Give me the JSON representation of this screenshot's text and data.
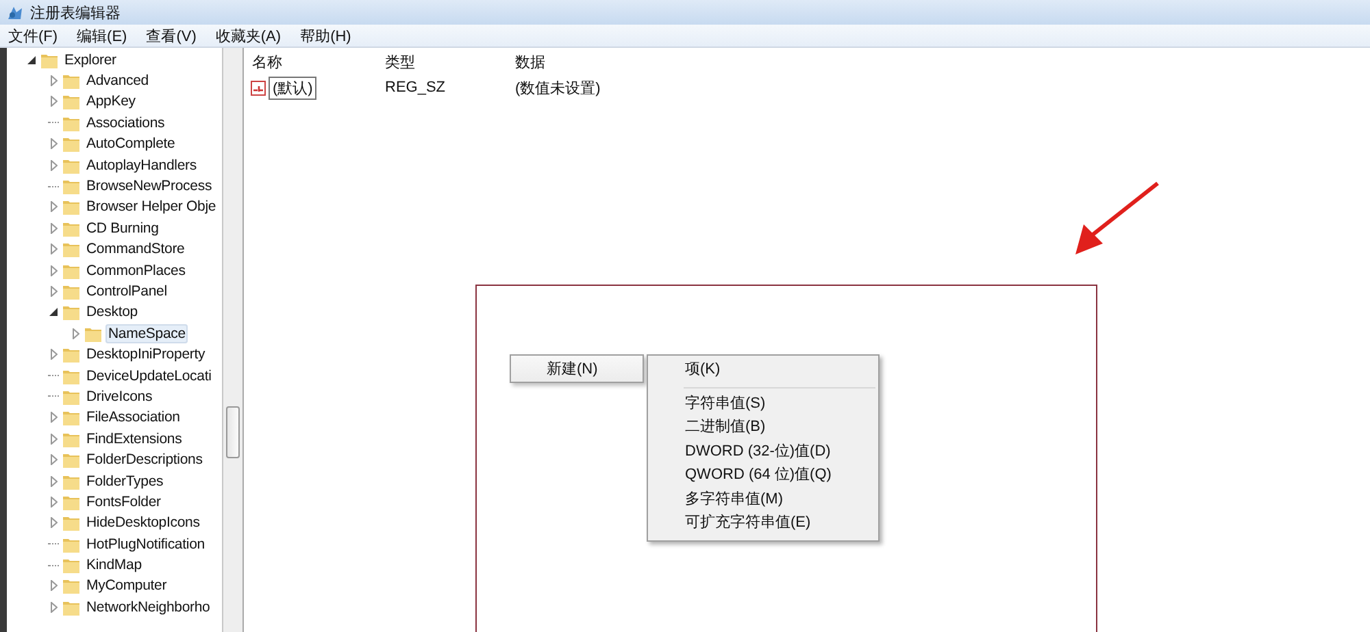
{
  "window": {
    "title": "注册表编辑器"
  },
  "menu_bar": [
    "文件(F)",
    "编辑(E)",
    "查看(V)",
    "收藏夹(A)",
    "帮助(H)"
  ],
  "tree": {
    "label": "Explorer",
    "kind": "branch",
    "expanded": true,
    "selected": false,
    "children": [
      {
        "label": "Advanced",
        "kind": "branch",
        "expanded": false,
        "selected": false
      },
      {
        "label": "AppKey",
        "kind": "branch",
        "expanded": false,
        "selected": false
      },
      {
        "label": "Associations",
        "kind": "leaf",
        "selected": false
      },
      {
        "label": "AutoComplete",
        "kind": "branch",
        "expanded": false,
        "selected": false
      },
      {
        "label": "AutoplayHandlers",
        "kind": "branch",
        "expanded": false,
        "selected": false
      },
      {
        "label": "BrowseNewProcess",
        "kind": "leaf",
        "selected": false
      },
      {
        "label": "Browser Helper Obje",
        "kind": "branch",
        "expanded": false,
        "selected": false
      },
      {
        "label": "CD Burning",
        "kind": "branch",
        "expanded": false,
        "selected": false
      },
      {
        "label": "CommandStore",
        "kind": "branch",
        "expanded": false,
        "selected": false
      },
      {
        "label": "CommonPlaces",
        "kind": "branch",
        "expanded": false,
        "selected": false
      },
      {
        "label": "ControlPanel",
        "kind": "branch",
        "expanded": false,
        "selected": false
      },
      {
        "label": "Desktop",
        "kind": "branch",
        "expanded": true,
        "selected": false,
        "children": [
          {
            "label": "NameSpace",
            "kind": "branch",
            "expanded": false,
            "selected": true
          }
        ]
      },
      {
        "label": "DesktopIniProperty",
        "kind": "branch",
        "expanded": false,
        "selected": false
      },
      {
        "label": "DeviceUpdateLocati",
        "kind": "leaf",
        "selected": false
      },
      {
        "label": "DriveIcons",
        "kind": "leaf",
        "selected": false
      },
      {
        "label": "FileAssociation",
        "kind": "branch",
        "expanded": false,
        "selected": false
      },
      {
        "label": "FindExtensions",
        "kind": "branch",
        "expanded": false,
        "selected": false
      },
      {
        "label": "FolderDescriptions",
        "kind": "branch",
        "expanded": false,
        "selected": false
      },
      {
        "label": "FolderTypes",
        "kind": "branch",
        "expanded": false,
        "selected": false
      },
      {
        "label": "FontsFolder",
        "kind": "branch",
        "expanded": false,
        "selected": false
      },
      {
        "label": "HideDesktopIcons",
        "kind": "branch",
        "expanded": false,
        "selected": false
      },
      {
        "label": "HotPlugNotification",
        "kind": "leaf",
        "selected": false
      },
      {
        "label": "KindMap",
        "kind": "leaf",
        "selected": false
      },
      {
        "label": "MyComputer",
        "kind": "branch",
        "expanded": false,
        "selected": false
      },
      {
        "label": "NetworkNeighborho",
        "kind": "branch",
        "expanded": false,
        "selected": false
      }
    ]
  },
  "values_pane": {
    "columns": [
      "名称",
      "类型",
      "数据"
    ],
    "rows": [
      {
        "name": "(默认)",
        "type": "REG_SZ",
        "data": "(数值未设置)"
      }
    ]
  },
  "context_menu": {
    "items": [
      {
        "label": "新建(N)",
        "kind": "submenu"
      }
    ]
  },
  "submenu": {
    "items": [
      {
        "label": "项(K)",
        "kind": "item"
      },
      {
        "kind": "separator"
      },
      {
        "label": "字符串值(S)",
        "kind": "item"
      },
      {
        "label": "二进制值(B)",
        "kind": "item"
      },
      {
        "label": "DWORD (32-位)值(D)",
        "kind": "item"
      },
      {
        "label": "QWORD (64 位)值(Q)",
        "kind": "item"
      },
      {
        "label": "多字符串值(M)",
        "kind": "item"
      },
      {
        "label": "可扩充字符串值(E)",
        "kind": "item"
      }
    ]
  }
}
